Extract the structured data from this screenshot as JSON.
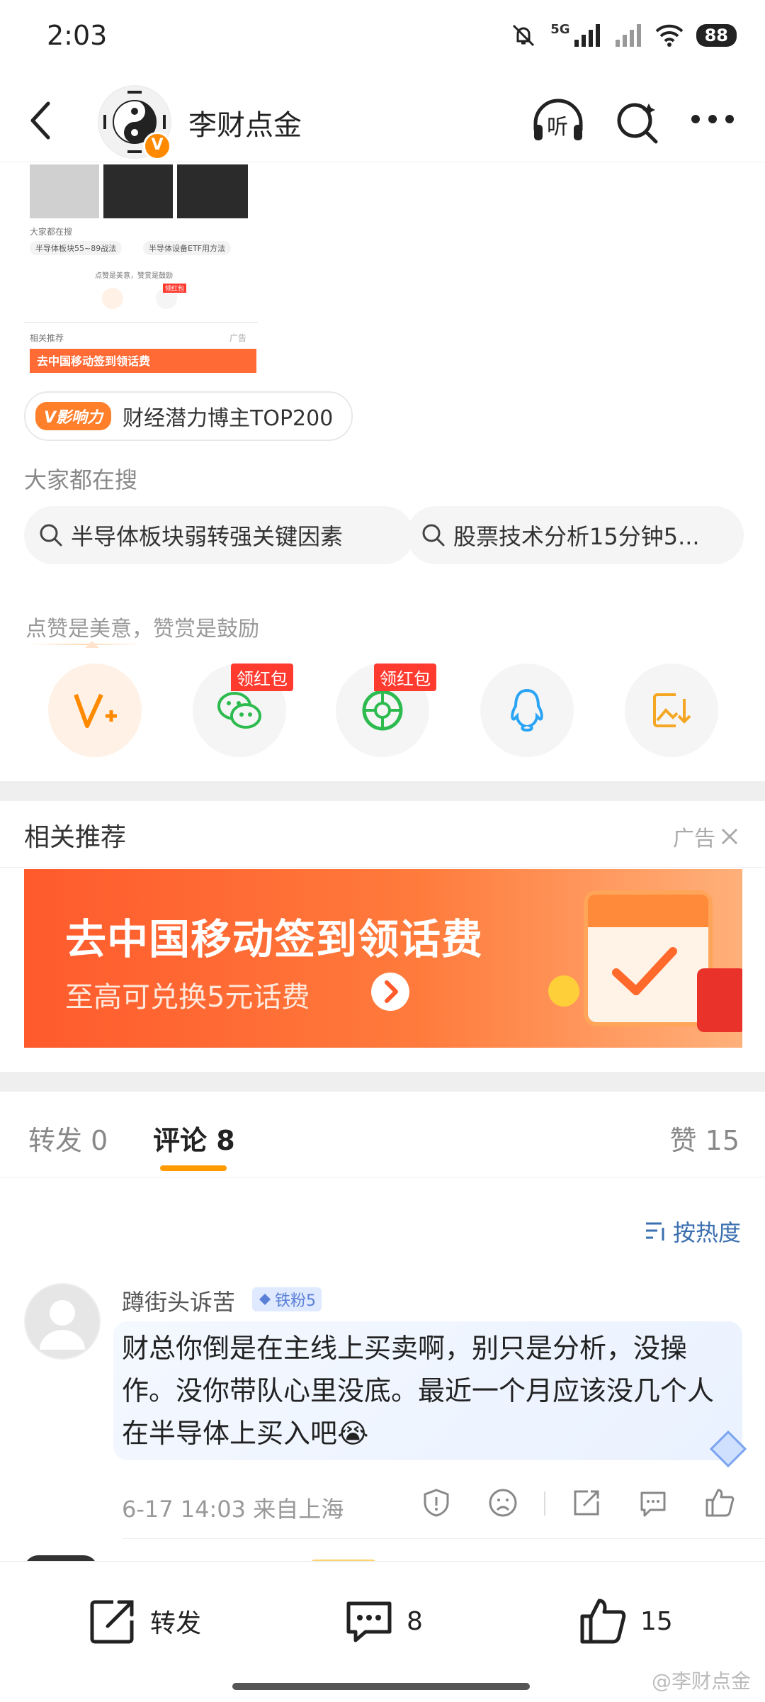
{
  "status_bar": {
    "time": "2:03",
    "network": "5G",
    "battery": "88"
  },
  "header": {
    "title": "李财点金",
    "badge": "V",
    "listen_label": "听"
  },
  "thumbnail": {
    "search_label": "大家都在搜",
    "chips": [
      "半导体板块55~89战法",
      "半导体设备ETF用方法"
    ],
    "reward_text": "点赞是美意，赞赏是鼓励",
    "related_label": "相关推荐",
    "ad_label": "广告",
    "banner_text": "去中国移动签到领话费",
    "red_tag": "领红包"
  },
  "influence": {
    "tag": "V影响力",
    "text": "财经潜力博主TOP200"
  },
  "search_section": {
    "label": "大家都在搜",
    "chips": [
      "半导体板块弱转强关键因素",
      "股票技术分析15分钟5..."
    ]
  },
  "reward": {
    "text": "点赞是美意，赞赏是鼓励",
    "red_tag": "领红包",
    "buttons": [
      "v-plus-icon",
      "wechat-icon",
      "moments-icon",
      "qq-icon",
      "save-image-icon"
    ]
  },
  "related": {
    "title": "相关推荐",
    "ad_label": "广告",
    "banner_headline": "去中国移动签到领话费",
    "banner_sub": "至高可兑换5元话费"
  },
  "tabs": {
    "forward_label": "转发",
    "forward_count": "0",
    "comment_label": "评论",
    "comment_count": "8",
    "like_label": "赞",
    "like_count": "15"
  },
  "sort": {
    "label": "按热度"
  },
  "comment": {
    "username": "蹲街头诉苦",
    "badge": "铁粉5",
    "text": "财总你倒是在主线上买卖啊，别只是分析，没操作。没你带队心里没底。最近一个月应该没几个人在半导体上买入吧😭",
    "time": "6-17 14:03",
    "location": "来自上海"
  },
  "bottom_bar": {
    "forward_label": "转发",
    "comment_count": "8",
    "like_count": "15"
  },
  "watermark": "@李财点金",
  "colors": {
    "accent": "#ff8a00",
    "link_blue": "#3a6fb0",
    "red_tag": "#ff3b30"
  }
}
